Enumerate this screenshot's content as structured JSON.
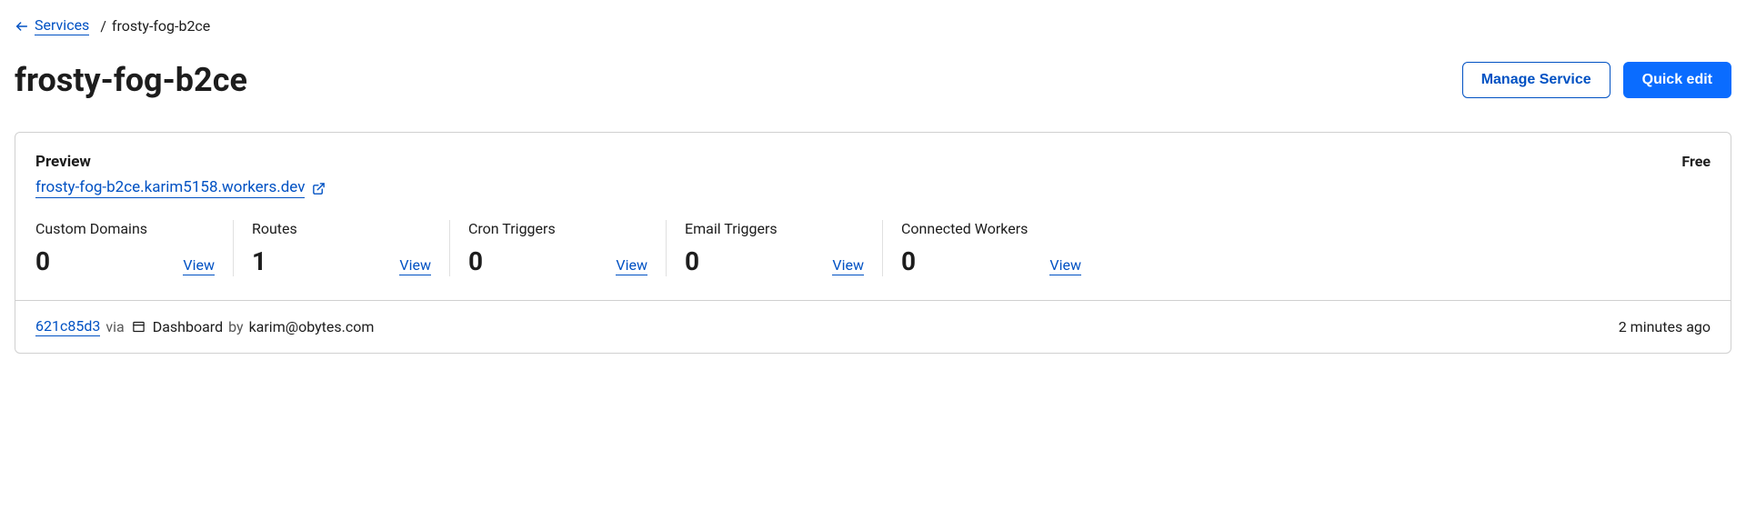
{
  "breadcrumb": {
    "parent": "Services",
    "separator": "/",
    "current": "frosty-fog-b2ce"
  },
  "header": {
    "title": "frosty-fog-b2ce",
    "actions": {
      "manage": "Manage Service",
      "quick_edit": "Quick edit"
    }
  },
  "preview": {
    "label": "Preview",
    "tier": "Free",
    "url": "frosty-fog-b2ce.karim5158.workers.dev"
  },
  "stats": {
    "custom_domains": {
      "label": "Custom Domains",
      "value": "0",
      "view": "View"
    },
    "routes": {
      "label": "Routes",
      "value": "1",
      "view": "View"
    },
    "cron_triggers": {
      "label": "Cron Triggers",
      "value": "0",
      "view": "View"
    },
    "email_triggers": {
      "label": "Email Triggers",
      "value": "0",
      "view": "View"
    },
    "connected_workers": {
      "label": "Connected Workers",
      "value": "0",
      "view": "View"
    }
  },
  "footer": {
    "commit": "621c85d3",
    "via": "via",
    "source": "Dashboard",
    "by": "by",
    "email": "karim@obytes.com",
    "timestamp": "2 minutes ago"
  }
}
